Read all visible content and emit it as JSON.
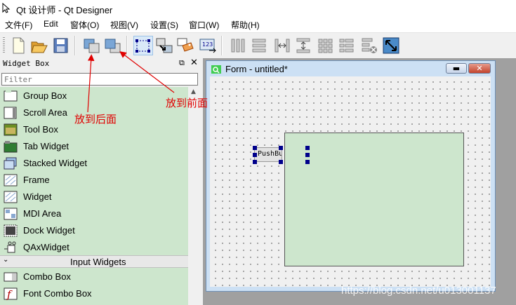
{
  "window": {
    "title": "Qt 设计师 - Qt Designer"
  },
  "menu": [
    "文件(F)",
    "Edit",
    "窗体(O)",
    "视图(V)",
    "设置(S)",
    "窗口(W)",
    "帮助(H)"
  ],
  "toolbar": {
    "icons": [
      "new-file-icon",
      "open-folder-icon",
      "save-icon",
      "send-to-back-icon",
      "bring-to-front-icon",
      "edit-widgets-icon",
      "edit-signals-slots-icon",
      "edit-buddies-icon",
      "edit-tab-order-icon",
      "layout-horizontal-icon",
      "layout-vertical-icon",
      "layout-horizontal-splitter-icon",
      "layout-vertical-splitter-icon",
      "layout-grid-icon",
      "layout-form-icon",
      "break-layout-icon",
      "adjust-size-icon"
    ]
  },
  "widget_box": {
    "title": "Widget Box",
    "filter_placeholder": "Filter",
    "containers": [
      {
        "label": "Group Box",
        "icon": "group-box-icon"
      },
      {
        "label": "Scroll Area",
        "icon": "scroll-area-icon"
      },
      {
        "label": "Tool Box",
        "icon": "tool-box-icon"
      },
      {
        "label": "Tab Widget",
        "icon": "tab-widget-icon"
      },
      {
        "label": "Stacked Widget",
        "icon": "stacked-widget-icon"
      },
      {
        "label": "Frame",
        "icon": "frame-icon"
      },
      {
        "label": "Widget",
        "icon": "widget-icon"
      },
      {
        "label": "MDI Area",
        "icon": "mdi-area-icon"
      },
      {
        "label": "Dock Widget",
        "icon": "dock-widget-icon"
      },
      {
        "label": "QAxWidget",
        "icon": "qaxwidget-icon"
      }
    ],
    "input_category": "Input Widgets",
    "inputs": [
      {
        "label": "Combo Box",
        "icon": "combo-box-icon"
      },
      {
        "label": "Font Combo Box",
        "icon": "font-combo-box-icon"
      }
    ]
  },
  "form": {
    "title": "Form - untitled*",
    "push_button_text": "PushButton"
  },
  "annotations": {
    "send_to_back": "放到后面",
    "bring_to_front": "放到前面"
  },
  "watermark": "https://blog.csdn.net/u013001137",
  "colors": {
    "widget_green": "#cde6cd",
    "annotation_red": "#e00000",
    "selection_handle": "#00008b"
  }
}
